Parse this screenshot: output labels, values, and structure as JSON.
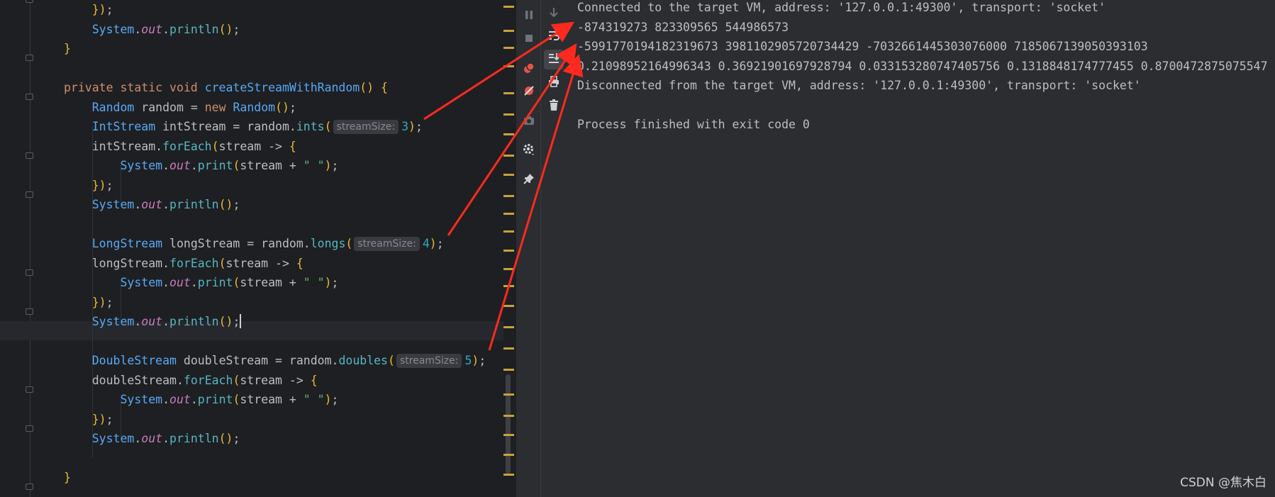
{
  "editor": {
    "lines": [
      [
        [
          "plain",
          "    "
        ],
        [
          "paren",
          "})"
        ],
        [
          "plain",
          ";"
        ]
      ],
      [
        [
          "plain",
          "    "
        ],
        [
          "type",
          "System"
        ],
        [
          "plain",
          "."
        ],
        [
          "field",
          "out"
        ],
        [
          "plain",
          "."
        ],
        [
          "method",
          "println"
        ],
        [
          "paren",
          "()"
        ],
        [
          "plain",
          ";"
        ]
      ],
      [
        [
          "paren",
          "}"
        ]
      ],
      [],
      [
        [
          "kw",
          "private static void "
        ],
        [
          "fn",
          "createStreamWithRandom"
        ],
        [
          "paren",
          "()"
        ],
        [
          "plain",
          " "
        ],
        [
          "paren",
          "{"
        ]
      ],
      [
        [
          "plain",
          "    "
        ],
        [
          "type",
          "Random"
        ],
        [
          "plain",
          " random = "
        ],
        [
          "kw",
          "new "
        ],
        [
          "type",
          "Random"
        ],
        [
          "paren",
          "()"
        ],
        [
          "plain",
          ";"
        ]
      ],
      [
        [
          "plain",
          "    "
        ],
        [
          "type",
          "IntStream"
        ],
        [
          "plain",
          " intStream = random."
        ],
        [
          "method",
          "ints"
        ],
        [
          "paren",
          "("
        ],
        [
          "hint",
          "streamSize:"
        ],
        [
          "num",
          "3"
        ],
        [
          "paren",
          ")"
        ],
        [
          "plain",
          ";"
        ]
      ],
      [
        [
          "plain",
          "    intStream."
        ],
        [
          "method",
          "forEach"
        ],
        [
          "paren",
          "("
        ],
        [
          "plain",
          "stream -> "
        ],
        [
          "paren",
          "{"
        ]
      ],
      [
        [
          "plain",
          "        "
        ],
        [
          "type",
          "System"
        ],
        [
          "plain",
          "."
        ],
        [
          "field",
          "out"
        ],
        [
          "plain",
          "."
        ],
        [
          "method",
          "print"
        ],
        [
          "paren",
          "("
        ],
        [
          "plain",
          "stream + "
        ],
        [
          "str",
          "\" \""
        ],
        [
          "paren",
          ")"
        ],
        [
          "plain",
          ";"
        ]
      ],
      [
        [
          "plain",
          "    "
        ],
        [
          "paren",
          "})"
        ],
        [
          "plain",
          ";"
        ]
      ],
      [
        [
          "plain",
          "    "
        ],
        [
          "type",
          "System"
        ],
        [
          "plain",
          "."
        ],
        [
          "field",
          "out"
        ],
        [
          "plain",
          "."
        ],
        [
          "method",
          "println"
        ],
        [
          "paren",
          "()"
        ],
        [
          "plain",
          ";"
        ]
      ],
      [],
      [
        [
          "plain",
          "    "
        ],
        [
          "type",
          "LongStream"
        ],
        [
          "plain",
          " longStream = random."
        ],
        [
          "method",
          "longs"
        ],
        [
          "paren",
          "("
        ],
        [
          "hint",
          "streamSize:"
        ],
        [
          "num",
          "4"
        ],
        [
          "paren",
          ")"
        ],
        [
          "plain",
          ";"
        ]
      ],
      [
        [
          "plain",
          "    longStream."
        ],
        [
          "method",
          "forEach"
        ],
        [
          "paren",
          "("
        ],
        [
          "plain",
          "stream -> "
        ],
        [
          "paren",
          "{"
        ]
      ],
      [
        [
          "plain",
          "        "
        ],
        [
          "type",
          "System"
        ],
        [
          "plain",
          "."
        ],
        [
          "field",
          "out"
        ],
        [
          "plain",
          "."
        ],
        [
          "method",
          "print"
        ],
        [
          "paren",
          "("
        ],
        [
          "plain",
          "stream + "
        ],
        [
          "str",
          "\" \""
        ],
        [
          "paren",
          ")"
        ],
        [
          "plain",
          ";"
        ]
      ],
      [
        [
          "plain",
          "    "
        ],
        [
          "paren",
          "})"
        ],
        [
          "plain",
          ";"
        ]
      ],
      [
        [
          "plain",
          "    "
        ],
        [
          "type",
          "System"
        ],
        [
          "plain",
          "."
        ],
        [
          "field",
          "out"
        ],
        [
          "plain",
          "."
        ],
        [
          "method",
          "println"
        ],
        [
          "paren",
          "()"
        ],
        [
          "plain",
          ";"
        ],
        [
          "caret",
          ""
        ]
      ],
      [],
      [
        [
          "plain",
          "    "
        ],
        [
          "type",
          "DoubleStream"
        ],
        [
          "plain",
          " doubleStream = random."
        ],
        [
          "method",
          "doubles"
        ],
        [
          "paren",
          "("
        ],
        [
          "hint",
          "streamSize:"
        ],
        [
          "num",
          "5"
        ],
        [
          "paren",
          ")"
        ],
        [
          "plain",
          ";"
        ]
      ],
      [
        [
          "plain",
          "    doubleStream."
        ],
        [
          "method",
          "forEach"
        ],
        [
          "paren",
          "("
        ],
        [
          "plain",
          "stream -> "
        ],
        [
          "paren",
          "{"
        ]
      ],
      [
        [
          "plain",
          "        "
        ],
        [
          "type",
          "System"
        ],
        [
          "plain",
          "."
        ],
        [
          "field",
          "out"
        ],
        [
          "plain",
          "."
        ],
        [
          "method",
          "print"
        ],
        [
          "paren",
          "("
        ],
        [
          "plain",
          "stream + "
        ],
        [
          "str",
          "\" \""
        ],
        [
          "paren",
          ")"
        ],
        [
          "plain",
          ";"
        ]
      ],
      [
        [
          "plain",
          "    "
        ],
        [
          "paren",
          "})"
        ],
        [
          "plain",
          ";"
        ]
      ],
      [
        [
          "plain",
          "    "
        ],
        [
          "type",
          "System"
        ],
        [
          "plain",
          "."
        ],
        [
          "field",
          "out"
        ],
        [
          "plain",
          "."
        ],
        [
          "method",
          "println"
        ],
        [
          "paren",
          "()"
        ],
        [
          "plain",
          ";"
        ]
      ],
      [],
      [
        [
          "paren",
          "}"
        ]
      ]
    ],
    "current_line_index": 16
  },
  "toolbar_left": [
    {
      "icon": "pause-icon"
    },
    {
      "icon": "stop-icon"
    },
    {
      "icon": "view-breakpoints-icon"
    },
    {
      "icon": "mute-breakpoints-icon"
    },
    {
      "icon": "camera-icon"
    },
    {
      "icon": "settings-icon"
    },
    {
      "icon": "pin-icon"
    }
  ],
  "toolbar_right": [
    {
      "icon": "scroll-down-icon"
    },
    {
      "icon": "soft-wrap-icon"
    },
    {
      "icon": "scroll-to-end-icon",
      "selected": true
    },
    {
      "icon": "print-icon"
    },
    {
      "icon": "trash-icon"
    }
  ],
  "console": {
    "lines": [
      "Connected to the target VM, address: '127.0.0.1:49300', transport: 'socket'",
      "-874319273 823309565 544986573",
      "-5991770194182319673 3981102905720734429 -7032661445303076000 7185067139050393103",
      "0.21098952164996343 0.36921901697928794 0.033153280747405756 0.1318848174777455 0.8700472875075547",
      "Disconnected from the target VM, address: '127.0.0.1:49300', transport: 'socket'",
      "",
      "Process finished with exit code 0"
    ]
  },
  "watermark": "CSDN @焦木白",
  "colors": {
    "annotation_arrow": "#ff2a1f",
    "stripe_mark": "#c6a23a"
  }
}
